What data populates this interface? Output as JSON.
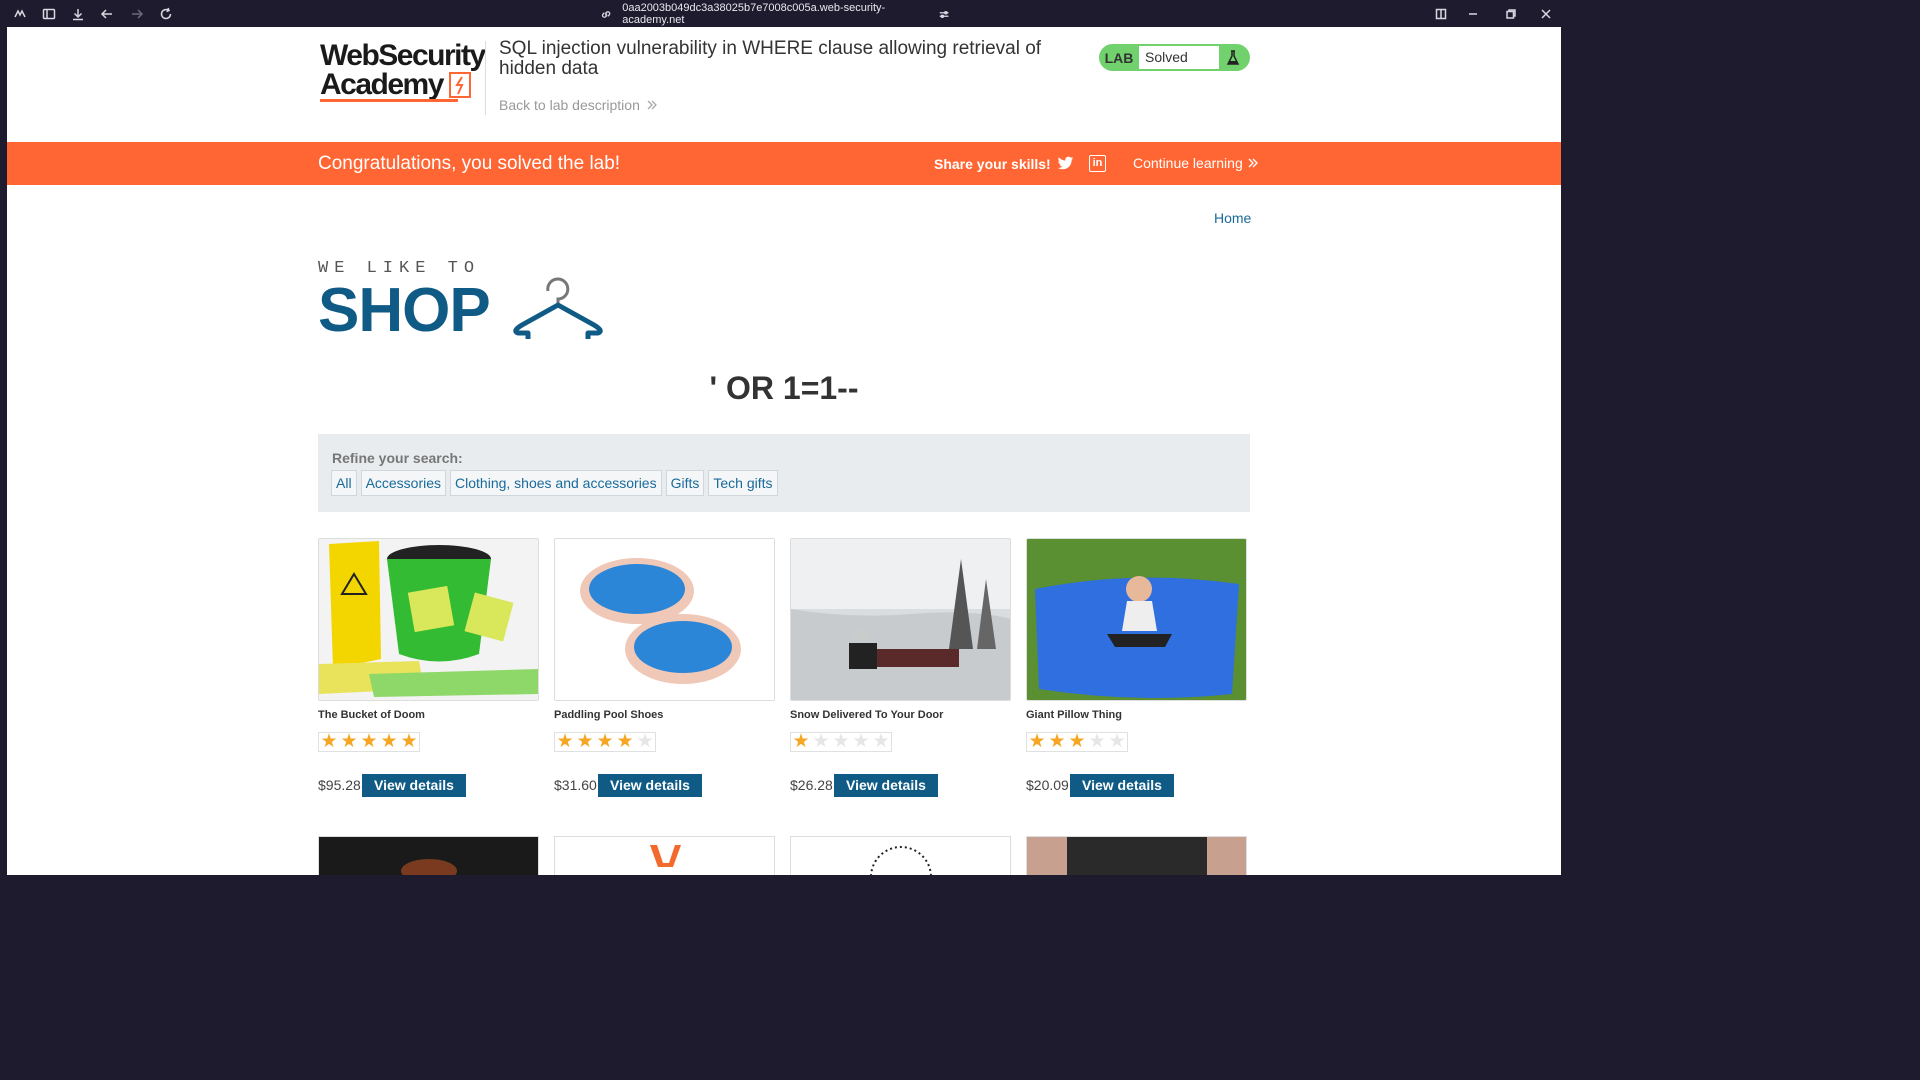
{
  "browser": {
    "url": "0aa2003b049dc3a38025b7e7008c005a.web-security-academy.net"
  },
  "header": {
    "logo_line1": "WebSecurity",
    "logo_line2": "Academy",
    "lab_title": "SQL injection vulnerability in WHERE clause allowing retrieval of hidden data",
    "back_link": "Back to lab description",
    "status_lab": "LAB",
    "status_value": "Solved"
  },
  "banner": {
    "message": "Congratulations, you solved the lab!",
    "share": "Share your skills!",
    "continue": "Continue learning",
    "linkedin_glyph": "in"
  },
  "nav": {
    "home": "Home"
  },
  "shop_logo": {
    "small": "WE LIKE TO",
    "big": "SHOP"
  },
  "query_heading": "' OR 1=1--",
  "refine": {
    "label": "Refine your search:",
    "filters": [
      "All",
      "Accessories",
      "Clothing, shoes and accessories",
      "Gifts",
      "Tech gifts"
    ]
  },
  "products": [
    {
      "name": "The Bucket of Doom",
      "rating": 5,
      "price": "$95.28",
      "button": "View details"
    },
    {
      "name": "Paddling Pool Shoes",
      "rating": 4,
      "price": "$31.60",
      "button": "View details"
    },
    {
      "name": "Snow Delivered To Your Door",
      "rating": 1,
      "price": "$26.28",
      "button": "View details"
    },
    {
      "name": "Giant Pillow Thing",
      "rating": 3,
      "price": "$20.09",
      "button": "View details"
    }
  ],
  "colors": {
    "accent_orange": "#ff6633",
    "primary_blue": "#0f5b85",
    "solved_green": "#70d16d",
    "star": "#f5a623"
  }
}
